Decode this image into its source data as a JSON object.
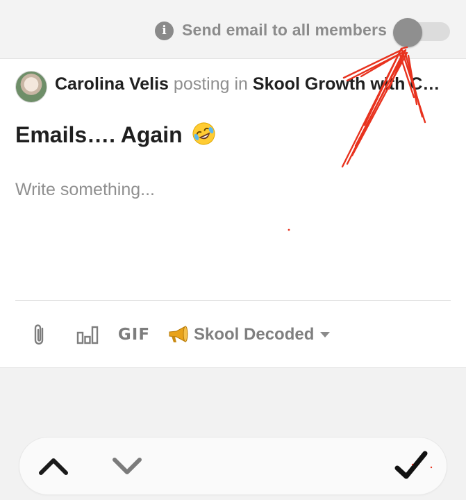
{
  "header": {
    "info_icon_glyph": "i",
    "send_email_label": "Send email to all members",
    "send_email_enabled": false
  },
  "post": {
    "author_name": "Carolina Velis",
    "posting_in_text": "posting in",
    "group_name": "Skool Growth with C…",
    "title": "Emails…. Again",
    "title_emoji": "rolling-on-the-floor-laughing-emoji",
    "body_placeholder": "Write something..."
  },
  "toolbar": {
    "attach_icon": "paperclip-icon",
    "poll_icon": "poll-icon",
    "gif_label": "GIF",
    "category_icon": "megaphone-icon",
    "category_label": "Skool Decoded",
    "category_caret_icon": "caret-down-icon"
  },
  "keyboard_bar": {
    "prev_icon": "chevron-up-icon",
    "next_icon": "chevron-down-icon",
    "done_icon": "checkmark-icon"
  },
  "colors": {
    "annotation_red": "#e8321e",
    "muted_gray": "#8b8b8b",
    "text_dark": "#202020"
  }
}
